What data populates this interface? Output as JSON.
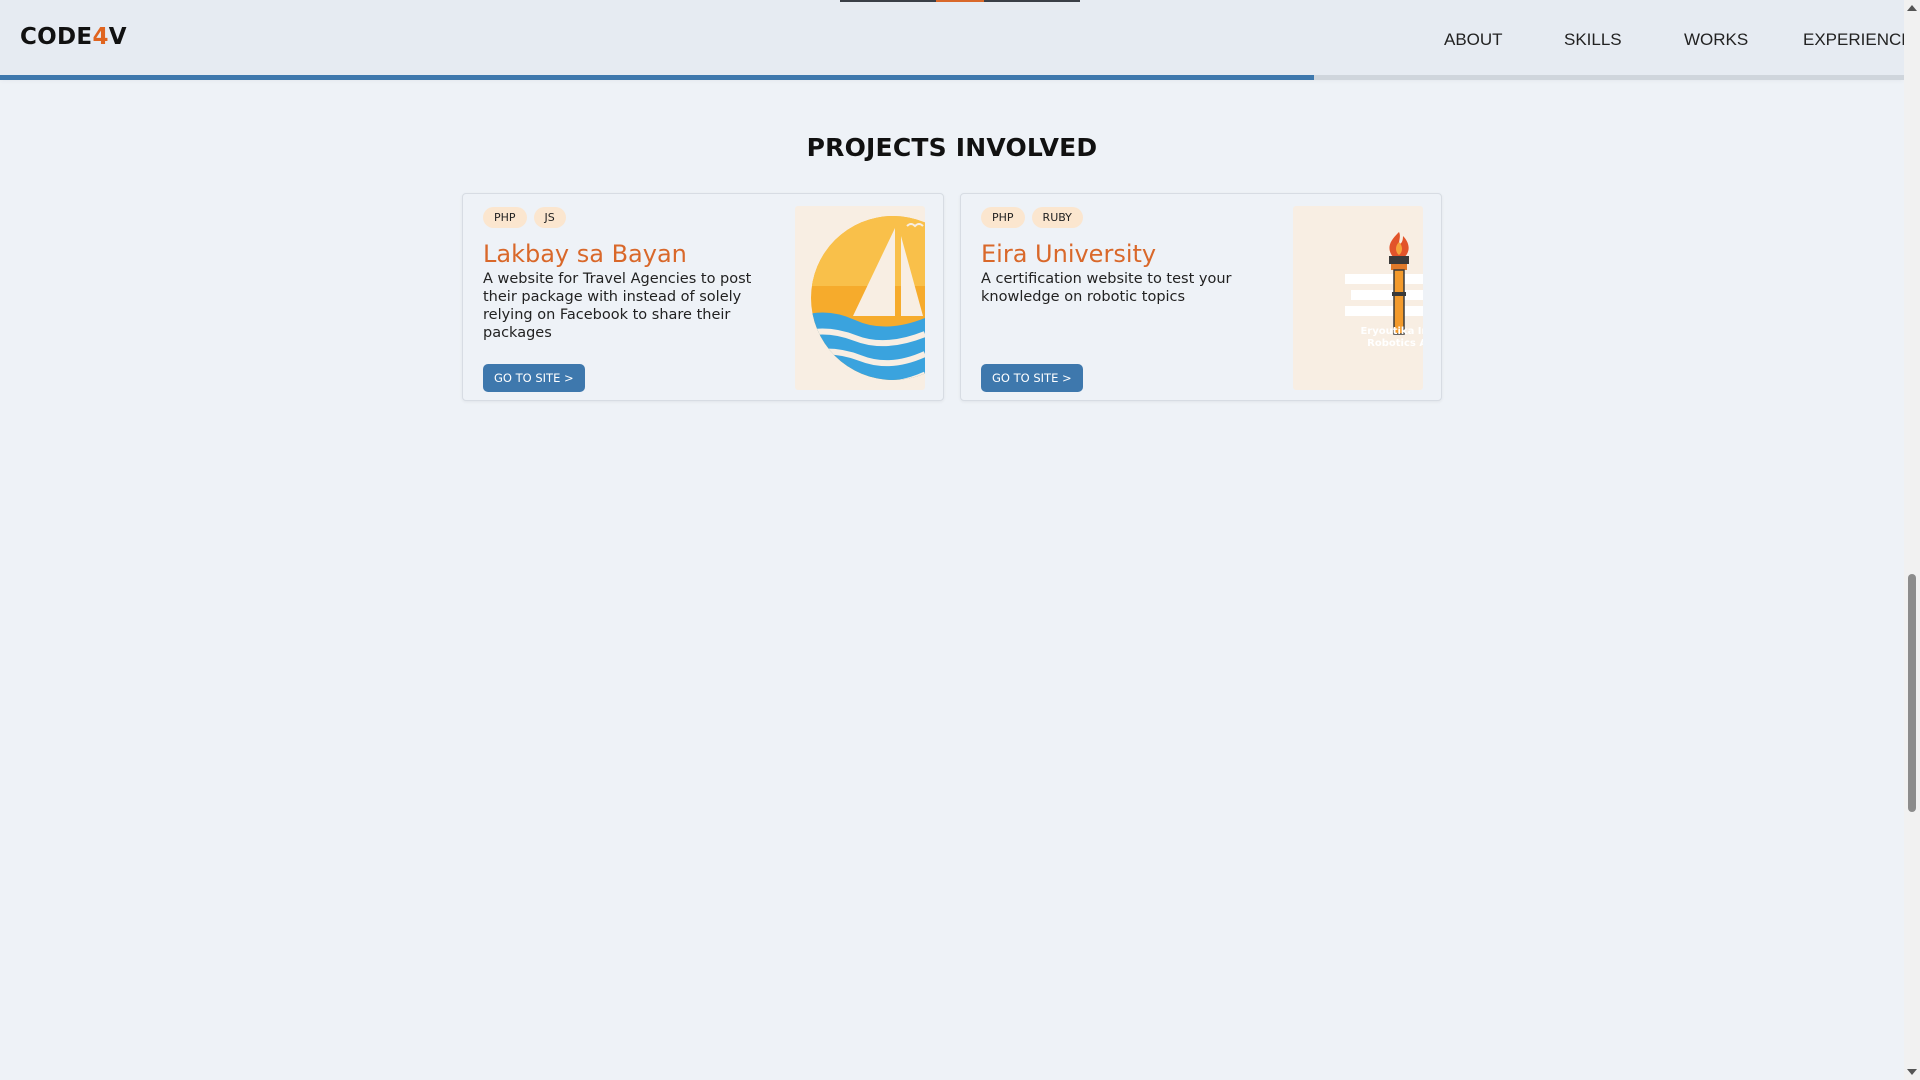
{
  "navbar": {
    "logo": {
      "prefix": "CODE",
      "accent": "4",
      "suffix": "V"
    },
    "links": [
      "ABOUT",
      "SKILLS",
      "WORKS",
      "EXPERIENCE"
    ],
    "scroll_progress_percent": 69
  },
  "section": {
    "title": "PROJECTS INVOLVED"
  },
  "projects": [
    {
      "tags": [
        "PHP",
        "JS"
      ],
      "title": "Lakbay sa Bayan",
      "description": "A website for Travel Agencies to post their package with instead of solely relying on Facebook to share their packages",
      "button_label": "GO TO SITE >",
      "image_icon": "sun-sailboat-logo"
    },
    {
      "tags": [
        "PHP",
        "RUBY"
      ],
      "title": "Eira University",
      "description": "A certification website to test your knowledge on robotic topics",
      "button_label": "GO TO SITE >",
      "image_icon": "torch-logo",
      "image_text": [
        "Eryoutika Inf",
        "Robotics Ac"
      ]
    }
  ],
  "colors": {
    "accent_orange": "#d9682a",
    "primary_blue": "#3e78ad",
    "tag_bg": "#fbe6cf",
    "page_bg": "#eef2f7"
  }
}
